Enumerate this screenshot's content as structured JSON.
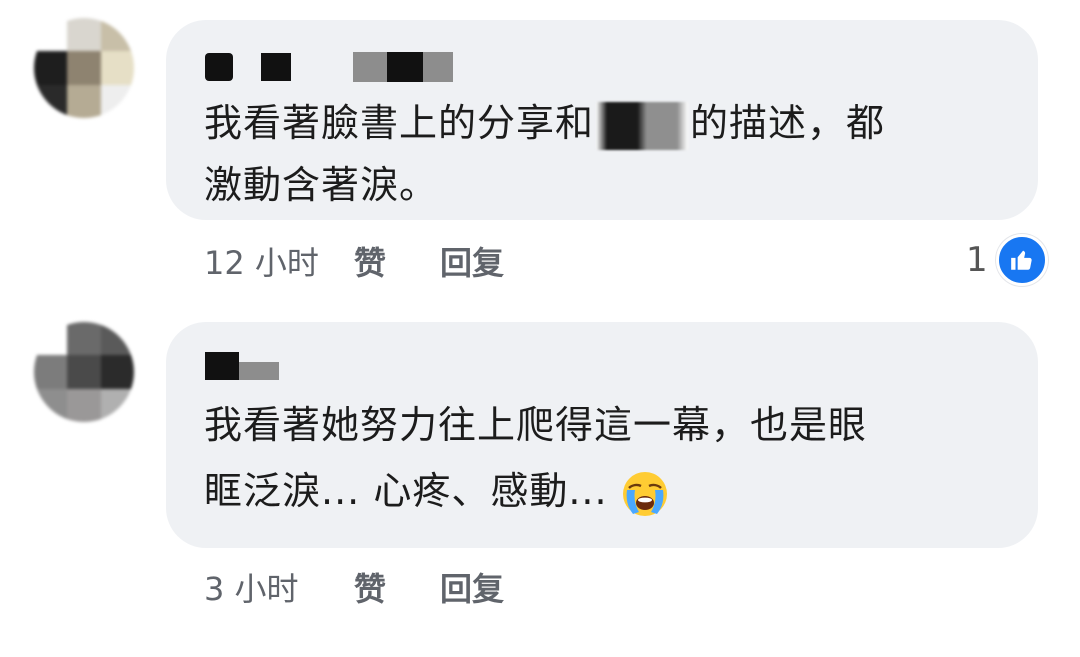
{
  "comments": [
    {
      "message_line1a": "我看著臉書上的分享和",
      "message_line1b": "的描述，都",
      "message_line2": "激動含著淚。",
      "time": "12 小时",
      "like_action": "赞",
      "reply_action": "回复",
      "like_count": "1"
    },
    {
      "message_line1": "我看著她努力往上爬得這一幕，也是眼",
      "message_line2": "眶泛淚... 心疼、感動...",
      "emoji": "loudly-crying-face",
      "time": "3 小时",
      "like_action": "赞",
      "reply_action": "回复"
    }
  ],
  "colors": {
    "bubble": "#eff1f4",
    "meta_text": "#60646b",
    "like_badge": "#1877f2"
  }
}
